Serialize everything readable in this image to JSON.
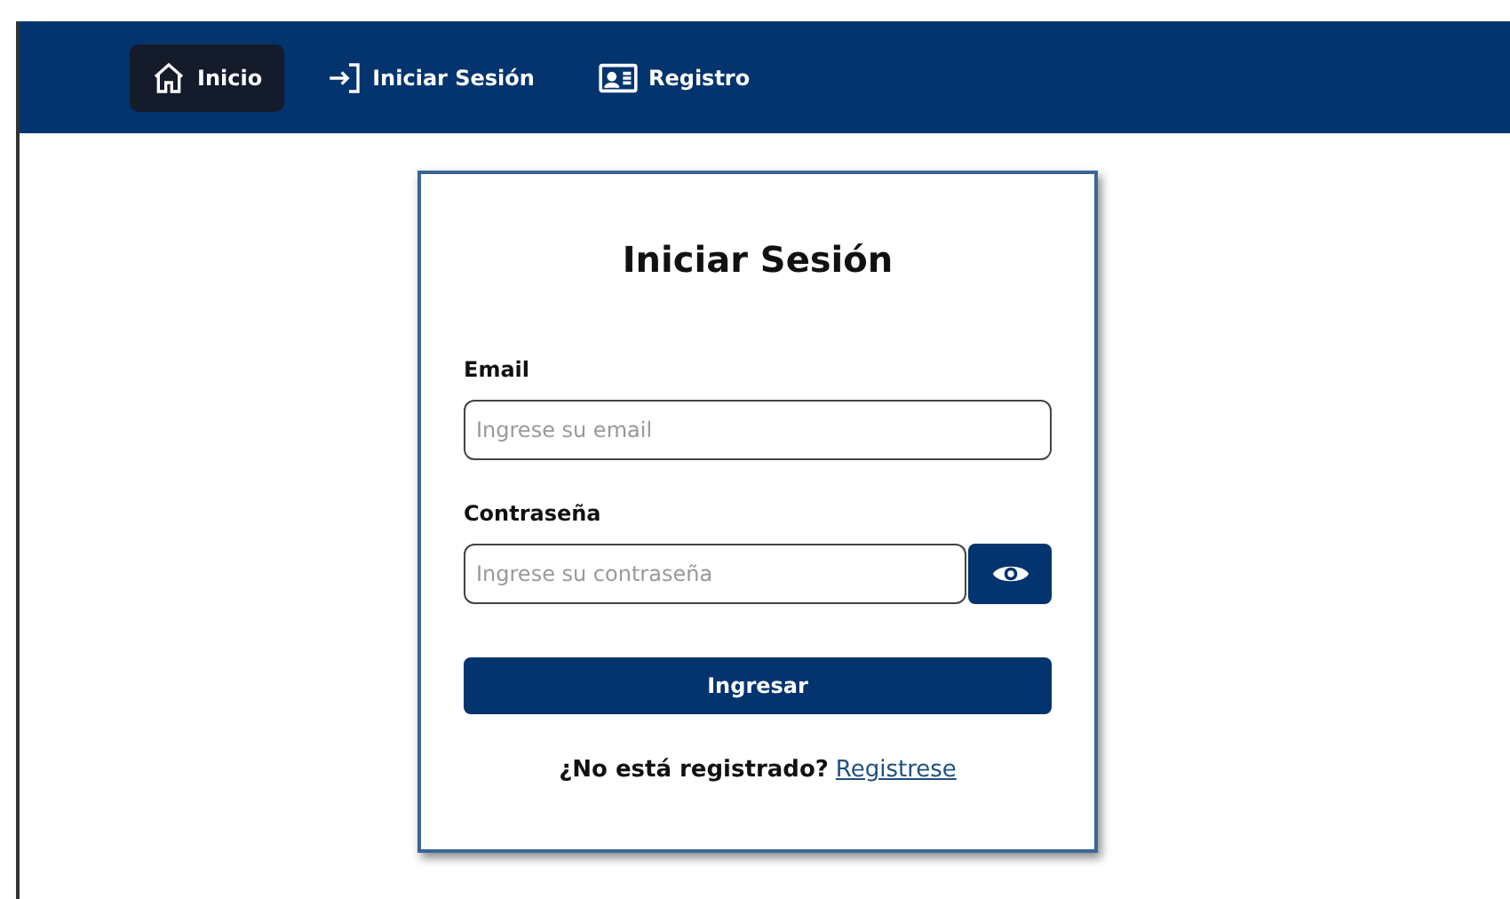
{
  "nav": [
    {
      "kind": "home",
      "label": "Inicio",
      "selected": true
    },
    {
      "kind": "login",
      "label": "Iniciar Sesión",
      "selected": false
    },
    {
      "kind": "card",
      "label": "Registro",
      "selected": false
    }
  ],
  "login": {
    "title": "Iniciar Sesión",
    "email": {
      "label": "Email",
      "placeholder": "Ingrese su email"
    },
    "password": {
      "label": "Contraseña",
      "placeholder": "Ingrese su contraseña"
    },
    "submit": "Ingresar",
    "footer": {
      "question": "¿No está registrado?",
      "link": "Registrese"
    }
  }
}
